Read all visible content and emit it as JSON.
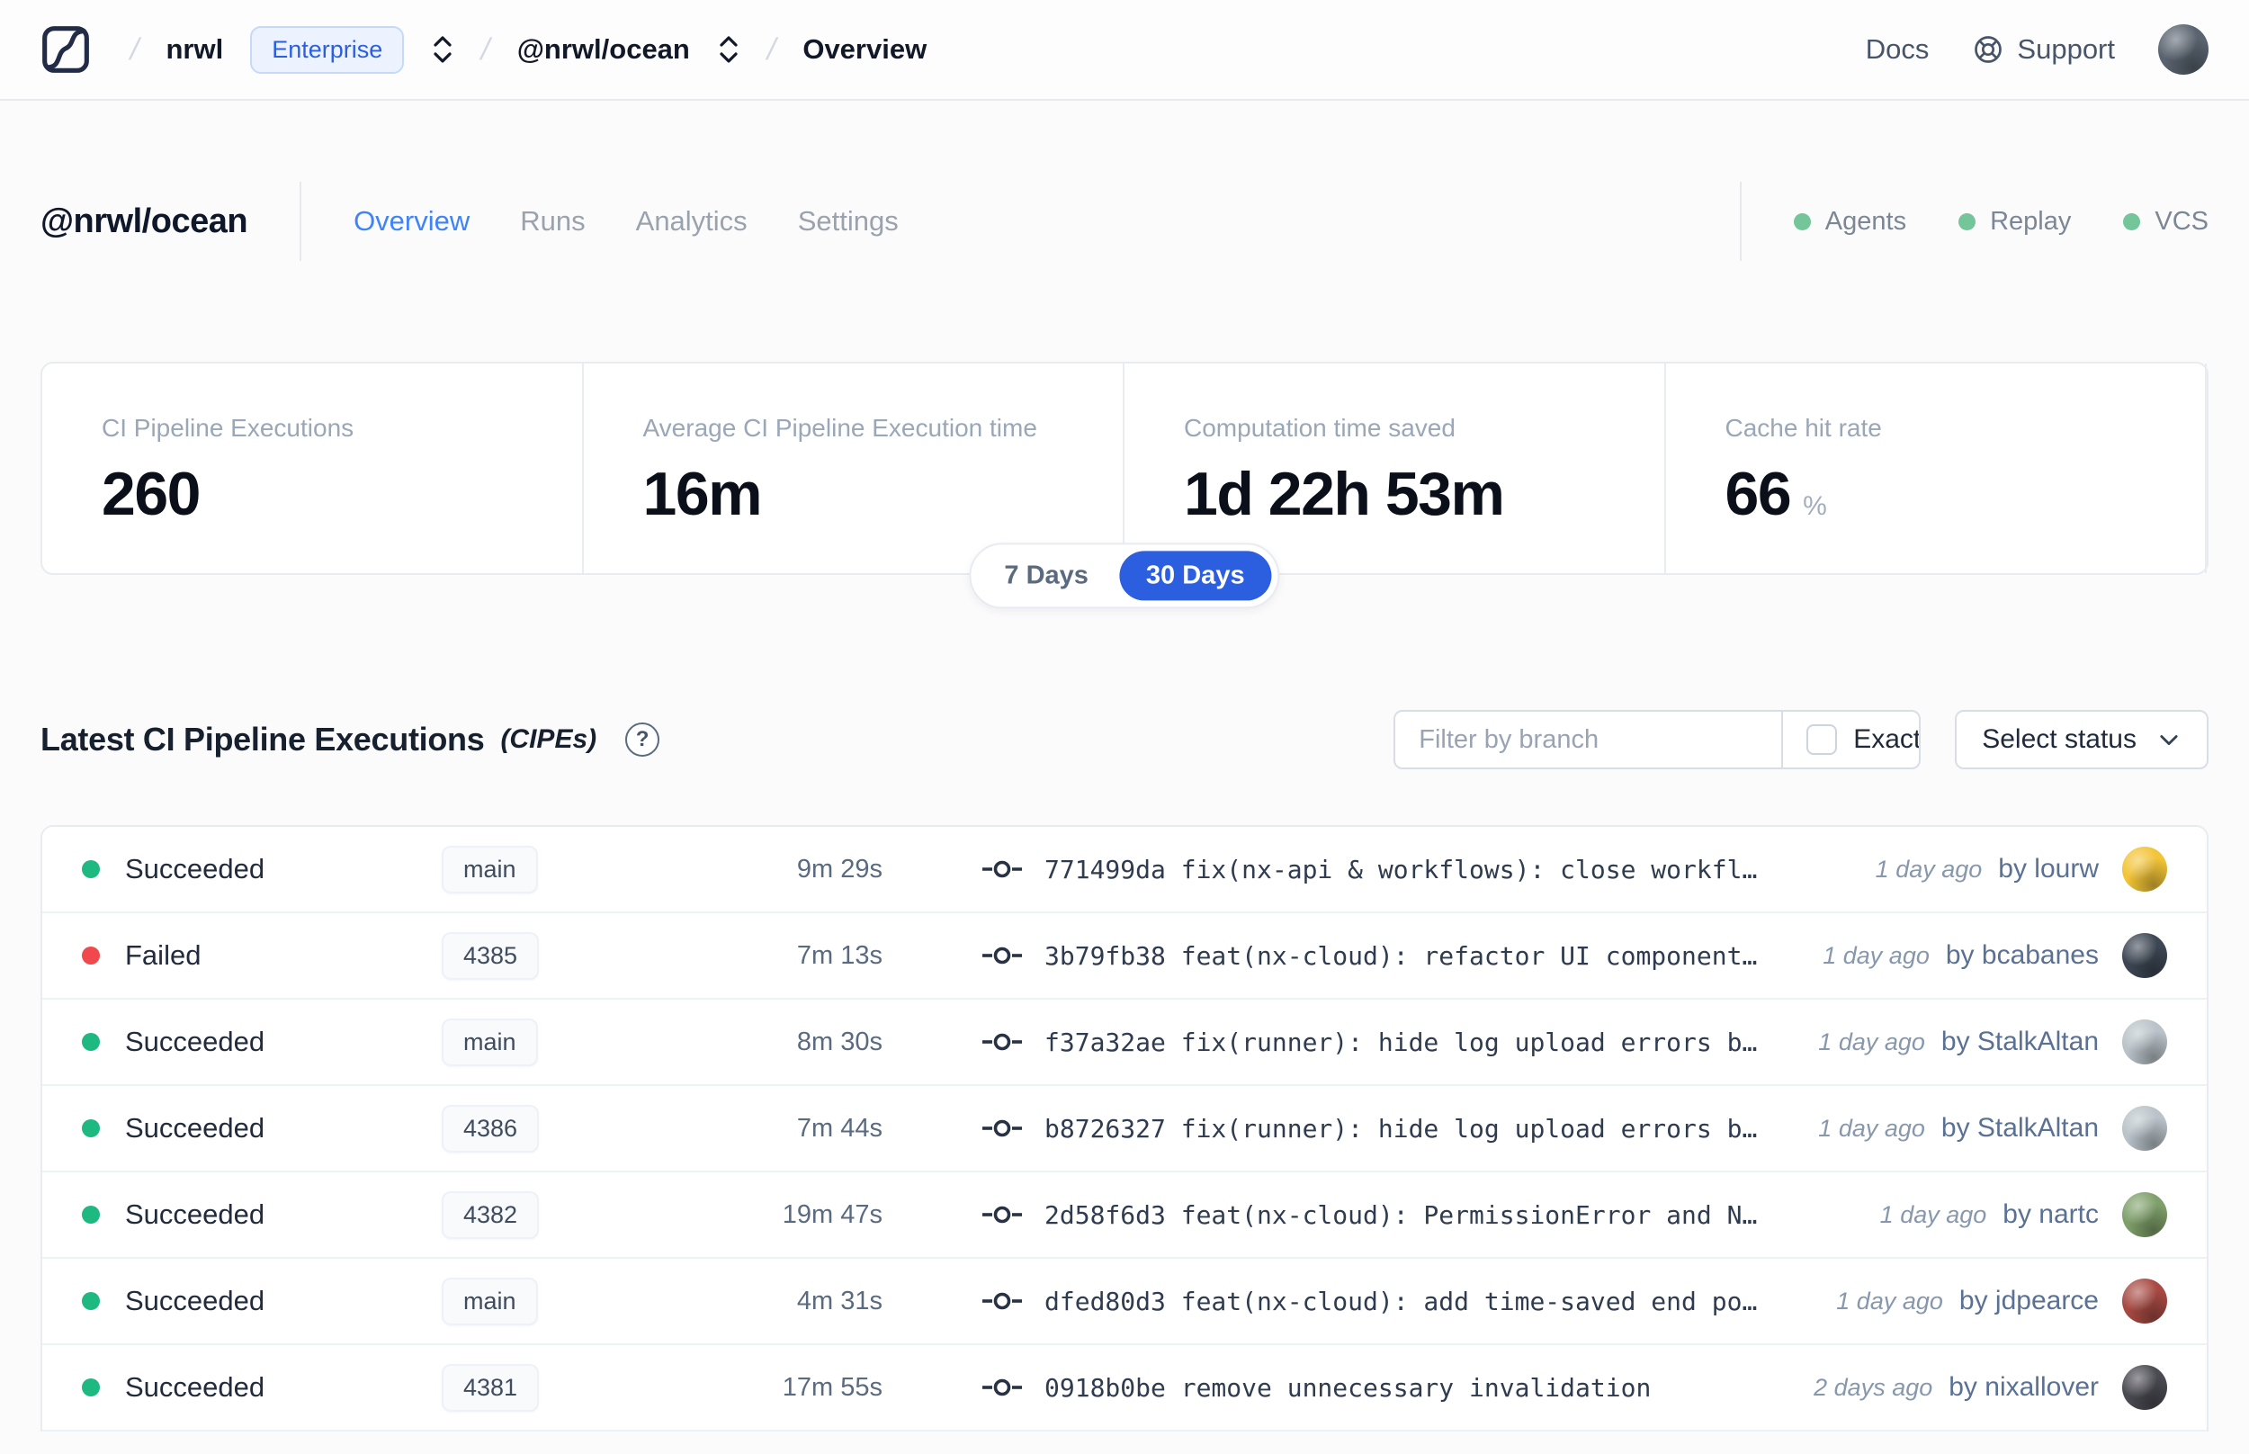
{
  "navbar": {
    "separator": "/",
    "org": "nrwl",
    "org_badge": "Enterprise",
    "workspace": "@nrwl/ocean",
    "page": "Overview",
    "docs_label": "Docs",
    "support_label": "Support",
    "user_avatar_color": "#5a6470"
  },
  "header": {
    "title": "@nrwl/ocean",
    "tabs": [
      {
        "label": "Overview",
        "active": true
      },
      {
        "label": "Runs",
        "active": false
      },
      {
        "label": "Analytics",
        "active": false
      },
      {
        "label": "Settings",
        "active": false
      }
    ],
    "statuses": [
      {
        "label": "Agents",
        "color": "#74c69a"
      },
      {
        "label": "Replay",
        "color": "#74c69a"
      },
      {
        "label": "VCS",
        "color": "#74c69a"
      }
    ]
  },
  "stats": {
    "cards": [
      {
        "label": "CI Pipeline Executions",
        "value": "260",
        "suffix": ""
      },
      {
        "label": "Average CI Pipeline Execution time",
        "value": "16m",
        "suffix": ""
      },
      {
        "label": "Computation time saved",
        "value": "1d 22h 53m",
        "suffix": ""
      },
      {
        "label": "Cache hit rate",
        "value": "66",
        "suffix": "%"
      }
    ],
    "range_toggle": {
      "options": [
        "7 Days",
        "30 Days"
      ],
      "selected": "30 Days",
      "active_color": "#2c5fe0"
    }
  },
  "cipe_section": {
    "title": "Latest CI Pipeline Executions",
    "title_suffix": "(CIPEs)",
    "help_glyph": "?",
    "filter": {
      "placeholder": "Filter by branch",
      "exact_label": "Exact",
      "exact_checked": false,
      "status_button_label": "Select status"
    },
    "rows": [
      {
        "status": "Succeeded",
        "dot_color": "#1db981",
        "branch": "main",
        "duration": "9m 29s",
        "commit": "771499da fix(nx-api & workflows): close workfl…",
        "time": "1 day ago",
        "author": "by lourw",
        "avatar_color": "#f2c437"
      },
      {
        "status": "Failed",
        "dot_color": "#f0484d",
        "branch": "4385",
        "duration": "7m 13s",
        "commit": "3b79fb38 feat(nx-cloud): refactor UI component…",
        "time": "1 day ago",
        "author": "by bcabanes",
        "avatar_color": "#3d4754"
      },
      {
        "status": "Succeeded",
        "dot_color": "#1db981",
        "branch": "main",
        "duration": "8m 30s",
        "commit": "f37a32ae fix(runner): hide log upload errors b…",
        "time": "1 day ago",
        "author": "by StalkAltan",
        "avatar_color": "#b9c3c9"
      },
      {
        "status": "Succeeded",
        "dot_color": "#1db981",
        "branch": "4386",
        "duration": "7m 44s",
        "commit": "b8726327 fix(runner): hide log upload errors b…",
        "time": "1 day ago",
        "author": "by StalkAltan",
        "avatar_color": "#b9c3c9"
      },
      {
        "status": "Succeeded",
        "dot_color": "#1db981",
        "branch": "4382",
        "duration": "19m 47s",
        "commit": "2d58f6d3 feat(nx-cloud): PermissionError and N…",
        "time": "1 day ago",
        "author": "by nartc",
        "avatar_color": "#7fa06a"
      },
      {
        "status": "Succeeded",
        "dot_color": "#1db981",
        "branch": "main",
        "duration": "4m 31s",
        "commit": "dfed80d3 feat(nx-cloud): add time-saved end po…",
        "time": "1 day ago",
        "author": "by jdpearce",
        "avatar_color": "#a84a43"
      },
      {
        "status": "Succeeded",
        "dot_color": "#1db981",
        "branch": "4381",
        "duration": "17m 55s",
        "commit": "0918b0be remove unnecessary invalidation",
        "time": "2 days ago",
        "author": "by nixallover",
        "avatar_color": "#4a4a52"
      }
    ]
  }
}
